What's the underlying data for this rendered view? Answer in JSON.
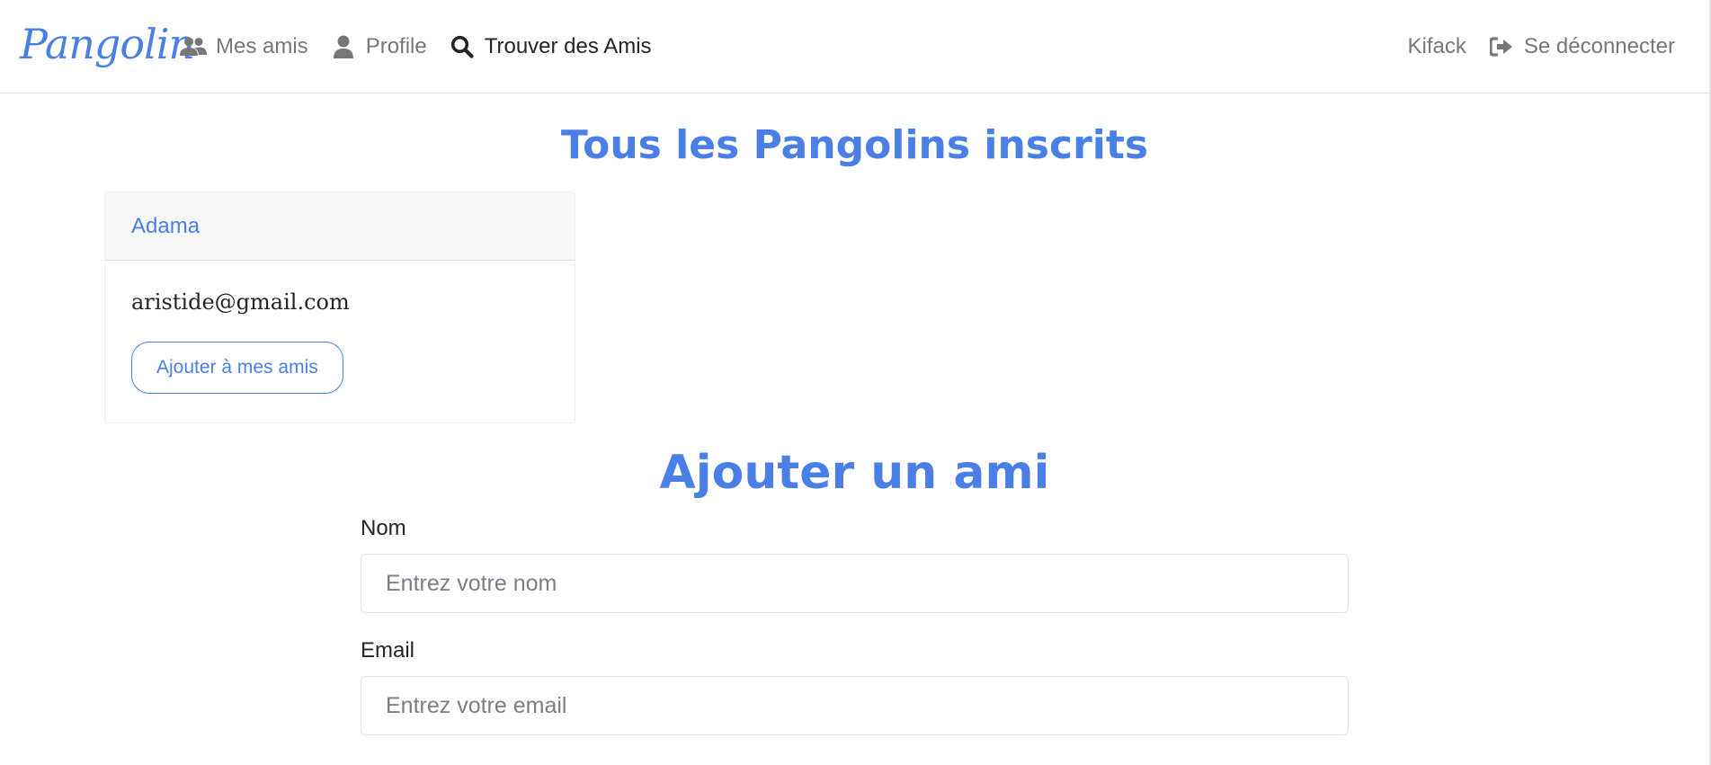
{
  "navbar": {
    "brand": "Pangolin",
    "links": [
      {
        "label": "Mes amis",
        "icon": "users-icon"
      },
      {
        "label": "Profile",
        "icon": "user-icon"
      },
      {
        "label": "Trouver des Amis",
        "icon": "search-icon",
        "active": true
      }
    ],
    "user_name": "Kifack",
    "logout_label": "Se déconnecter",
    "logout_icon": "sign-out-icon"
  },
  "registered": {
    "title": "Tous les Pangolins inscrits",
    "cards": [
      {
        "name": "Adama",
        "email": "aristide@gmail.com",
        "button_label": "Ajouter à mes amis"
      }
    ]
  },
  "add_friend": {
    "title": "Ajouter un ami",
    "name_label": "Nom",
    "name_value": "",
    "name_placeholder": "Entrez votre nom",
    "email_label": "Email",
    "email_value": "",
    "email_placeholder": "Entrez votre email"
  },
  "colors": {
    "accent": "#4a7fe6",
    "nav_text": "#777777",
    "text": "#212529"
  }
}
